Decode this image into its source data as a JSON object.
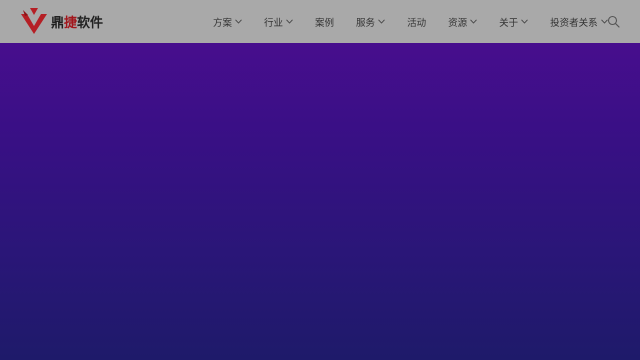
{
  "logo": {
    "text_part1": "鼎",
    "text_highlight": "捷",
    "text_part2": "软件"
  },
  "nav": {
    "items": [
      {
        "label": "方案",
        "has_dropdown": true
      },
      {
        "label": "行业",
        "has_dropdown": true
      },
      {
        "label": "案例",
        "has_dropdown": false
      },
      {
        "label": "服务",
        "has_dropdown": true
      },
      {
        "label": "活动",
        "has_dropdown": false
      },
      {
        "label": "资源",
        "has_dropdown": true
      },
      {
        "label": "关于",
        "has_dropdown": true
      },
      {
        "label": "投资者关系",
        "has_dropdown": true
      }
    ]
  },
  "icons": {
    "search": "search-icon",
    "dropdown": "chevron-down-icon",
    "logo": "logo-icon"
  },
  "colors": {
    "header_bg": "#a9a9a9",
    "brand_red": "#a3161c",
    "hero_top": "#4e0e91",
    "hero_bottom": "#1e1a6a"
  }
}
